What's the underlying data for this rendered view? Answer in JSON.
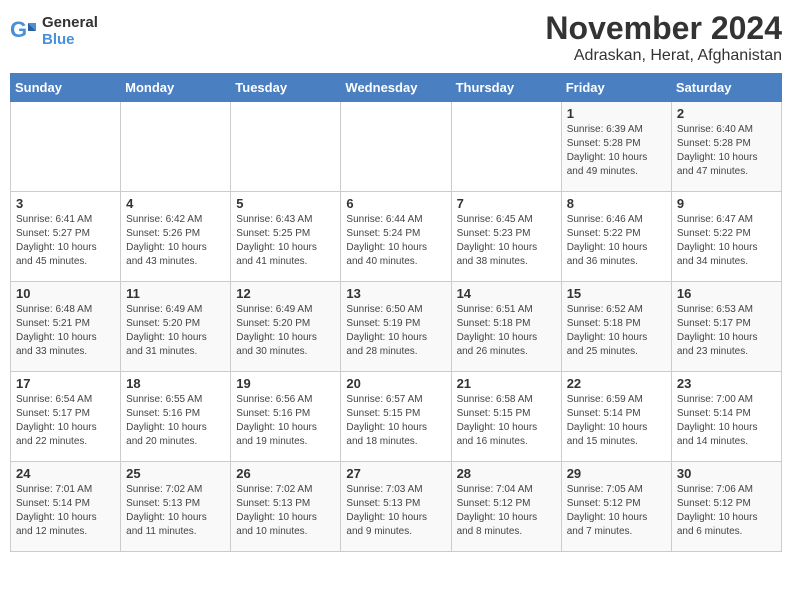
{
  "header": {
    "logo_line1": "General",
    "logo_line2": "Blue",
    "month": "November 2024",
    "location": "Adraskan, Herat, Afghanistan"
  },
  "weekdays": [
    "Sunday",
    "Monday",
    "Tuesday",
    "Wednesday",
    "Thursday",
    "Friday",
    "Saturday"
  ],
  "weeks": [
    [
      {
        "day": "",
        "info": ""
      },
      {
        "day": "",
        "info": ""
      },
      {
        "day": "",
        "info": ""
      },
      {
        "day": "",
        "info": ""
      },
      {
        "day": "",
        "info": ""
      },
      {
        "day": "1",
        "info": "Sunrise: 6:39 AM\nSunset: 5:28 PM\nDaylight: 10 hours\nand 49 minutes."
      },
      {
        "day": "2",
        "info": "Sunrise: 6:40 AM\nSunset: 5:28 PM\nDaylight: 10 hours\nand 47 minutes."
      }
    ],
    [
      {
        "day": "3",
        "info": "Sunrise: 6:41 AM\nSunset: 5:27 PM\nDaylight: 10 hours\nand 45 minutes."
      },
      {
        "day": "4",
        "info": "Sunrise: 6:42 AM\nSunset: 5:26 PM\nDaylight: 10 hours\nand 43 minutes."
      },
      {
        "day": "5",
        "info": "Sunrise: 6:43 AM\nSunset: 5:25 PM\nDaylight: 10 hours\nand 41 minutes."
      },
      {
        "day": "6",
        "info": "Sunrise: 6:44 AM\nSunset: 5:24 PM\nDaylight: 10 hours\nand 40 minutes."
      },
      {
        "day": "7",
        "info": "Sunrise: 6:45 AM\nSunset: 5:23 PM\nDaylight: 10 hours\nand 38 minutes."
      },
      {
        "day": "8",
        "info": "Sunrise: 6:46 AM\nSunset: 5:22 PM\nDaylight: 10 hours\nand 36 minutes."
      },
      {
        "day": "9",
        "info": "Sunrise: 6:47 AM\nSunset: 5:22 PM\nDaylight: 10 hours\nand 34 minutes."
      }
    ],
    [
      {
        "day": "10",
        "info": "Sunrise: 6:48 AM\nSunset: 5:21 PM\nDaylight: 10 hours\nand 33 minutes."
      },
      {
        "day": "11",
        "info": "Sunrise: 6:49 AM\nSunset: 5:20 PM\nDaylight: 10 hours\nand 31 minutes."
      },
      {
        "day": "12",
        "info": "Sunrise: 6:49 AM\nSunset: 5:20 PM\nDaylight: 10 hours\nand 30 minutes."
      },
      {
        "day": "13",
        "info": "Sunrise: 6:50 AM\nSunset: 5:19 PM\nDaylight: 10 hours\nand 28 minutes."
      },
      {
        "day": "14",
        "info": "Sunrise: 6:51 AM\nSunset: 5:18 PM\nDaylight: 10 hours\nand 26 minutes."
      },
      {
        "day": "15",
        "info": "Sunrise: 6:52 AM\nSunset: 5:18 PM\nDaylight: 10 hours\nand 25 minutes."
      },
      {
        "day": "16",
        "info": "Sunrise: 6:53 AM\nSunset: 5:17 PM\nDaylight: 10 hours\nand 23 minutes."
      }
    ],
    [
      {
        "day": "17",
        "info": "Sunrise: 6:54 AM\nSunset: 5:17 PM\nDaylight: 10 hours\nand 22 minutes."
      },
      {
        "day": "18",
        "info": "Sunrise: 6:55 AM\nSunset: 5:16 PM\nDaylight: 10 hours\nand 20 minutes."
      },
      {
        "day": "19",
        "info": "Sunrise: 6:56 AM\nSunset: 5:16 PM\nDaylight: 10 hours\nand 19 minutes."
      },
      {
        "day": "20",
        "info": "Sunrise: 6:57 AM\nSunset: 5:15 PM\nDaylight: 10 hours\nand 18 minutes."
      },
      {
        "day": "21",
        "info": "Sunrise: 6:58 AM\nSunset: 5:15 PM\nDaylight: 10 hours\nand 16 minutes."
      },
      {
        "day": "22",
        "info": "Sunrise: 6:59 AM\nSunset: 5:14 PM\nDaylight: 10 hours\nand 15 minutes."
      },
      {
        "day": "23",
        "info": "Sunrise: 7:00 AM\nSunset: 5:14 PM\nDaylight: 10 hours\nand 14 minutes."
      }
    ],
    [
      {
        "day": "24",
        "info": "Sunrise: 7:01 AM\nSunset: 5:14 PM\nDaylight: 10 hours\nand 12 minutes."
      },
      {
        "day": "25",
        "info": "Sunrise: 7:02 AM\nSunset: 5:13 PM\nDaylight: 10 hours\nand 11 minutes."
      },
      {
        "day": "26",
        "info": "Sunrise: 7:02 AM\nSunset: 5:13 PM\nDaylight: 10 hours\nand 10 minutes."
      },
      {
        "day": "27",
        "info": "Sunrise: 7:03 AM\nSunset: 5:13 PM\nDaylight: 10 hours\nand 9 minutes."
      },
      {
        "day": "28",
        "info": "Sunrise: 7:04 AM\nSunset: 5:12 PM\nDaylight: 10 hours\nand 8 minutes."
      },
      {
        "day": "29",
        "info": "Sunrise: 7:05 AM\nSunset: 5:12 PM\nDaylight: 10 hours\nand 7 minutes."
      },
      {
        "day": "30",
        "info": "Sunrise: 7:06 AM\nSunset: 5:12 PM\nDaylight: 10 hours\nand 6 minutes."
      }
    ]
  ]
}
